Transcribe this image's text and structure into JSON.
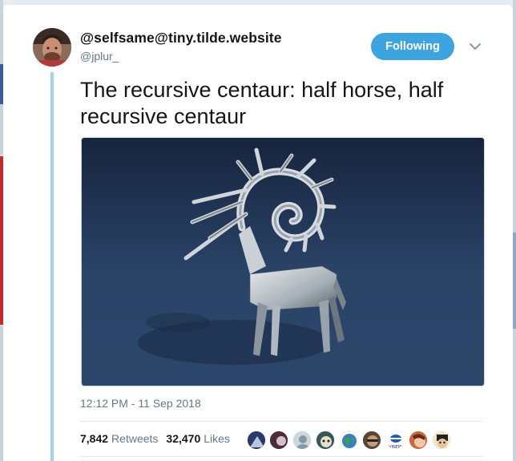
{
  "tweet": {
    "display_name": "@selfsame@tiny.tilde.website",
    "handle": "@jplur_",
    "follow_label": "Following",
    "text": "The recursive centaur: half horse, half recursive centaur",
    "timestamp": "12:12 PM - 11 Sep 2018"
  },
  "stats": {
    "retweets_count": "7,842",
    "retweets_label": "Retweets",
    "likes_count": "32,470",
    "likes_label": "Likes"
  },
  "likers": [
    {
      "icon": "liker-avatar-1",
      "color": "#2b3a6b"
    },
    {
      "icon": "liker-avatar-2",
      "color": "#4b2c3a"
    },
    {
      "icon": "liker-avatar-default",
      "color": "#aab8c2"
    },
    {
      "icon": "liker-avatar-4",
      "color": "#36575a"
    },
    {
      "icon": "liker-avatar-globe",
      "color": "#3b7a4a"
    },
    {
      "icon": "liker-avatar-6",
      "color": "#5a4636"
    },
    {
      "icon": "liker-avatar-logo",
      "color": "#ffffff"
    },
    {
      "icon": "liker-avatar-8",
      "color": "#c76a3e"
    },
    {
      "icon": "liker-avatar-9",
      "color": "#e0c79a"
    }
  ],
  "logo_text": "VINEPY",
  "colors": {
    "accent": "#3da4e0",
    "thread_line": "#a3d2ed",
    "media_bg": "#1f3150"
  }
}
